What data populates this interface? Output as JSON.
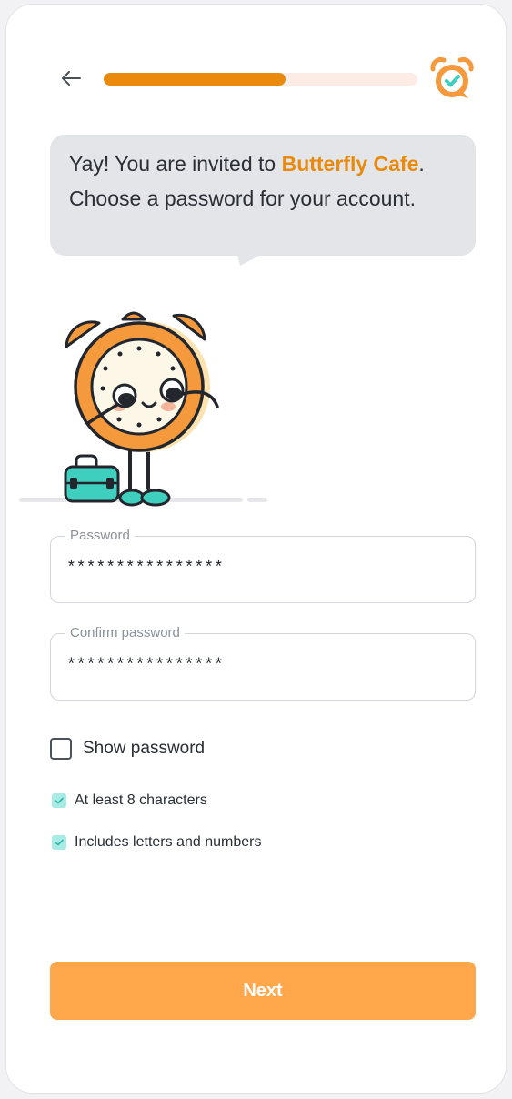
{
  "header": {
    "progress": 0.58
  },
  "message": {
    "line1_prefix": "Yay! You are invited to ",
    "company_name": "Butterfly Cafe",
    "line1_suffix": ".",
    "line2": "Choose a password for your account."
  },
  "form": {
    "password_label": "Password",
    "password_value": "****************",
    "confirm_label": "Confirm password",
    "confirm_value": "****************",
    "show_password_label": "Show password",
    "show_password_checked": false
  },
  "requirements": [
    {
      "label": "At least 8 characters",
      "met": true
    },
    {
      "label": "Includes letters and numbers",
      "met": true
    }
  ],
  "actions": {
    "next_label": "Next"
  },
  "icons": {
    "back": "arrow-left-icon",
    "app": "alarm-clock-check-icon",
    "mascot": "alarm-clock-mascot-illustration"
  },
  "colors": {
    "accent": "#e98a0c",
    "button": "#ffa74a",
    "progress_track": "#fdece5",
    "bubble": "#e4e5e9",
    "check": "#a8ebe4",
    "teal": "#3fcfbe"
  }
}
